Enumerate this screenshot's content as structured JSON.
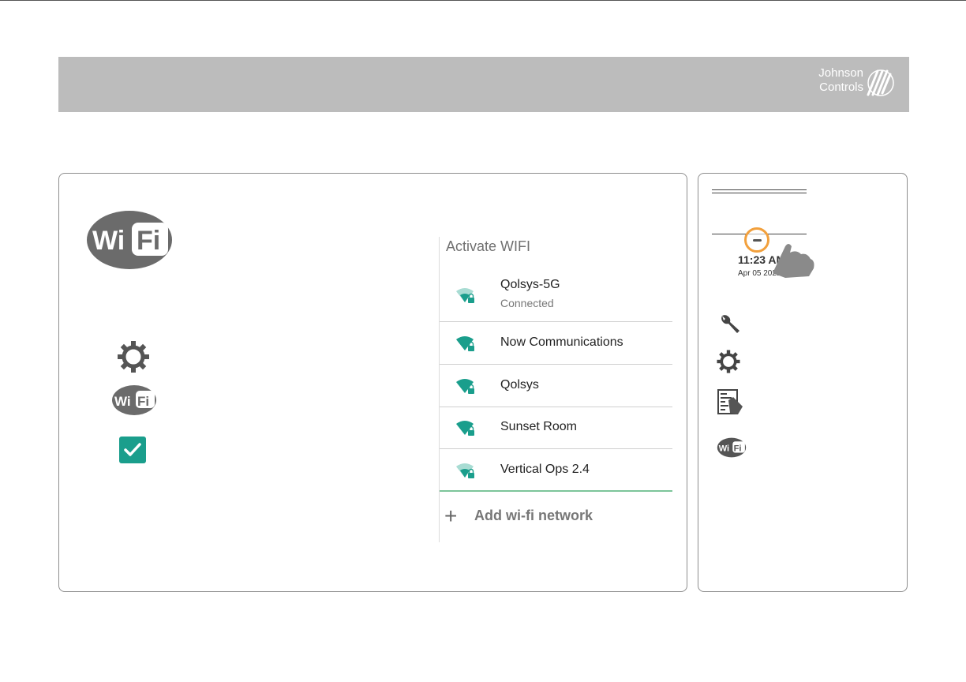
{
  "brand": {
    "line1": "Johnson",
    "line2": "Controls"
  },
  "main_logo": {
    "left": "Wi",
    "right": "Fi"
  },
  "screen": {
    "title": "Activate WIFI",
    "networks": [
      {
        "name": "Qolsys-5G",
        "status": "Connected",
        "signal": "partial"
      },
      {
        "name": "Now Communications",
        "status": "",
        "signal": "full"
      },
      {
        "name": "Qolsys",
        "status": "",
        "signal": "full"
      },
      {
        "name": "Sunset Room",
        "status": "",
        "signal": "full"
      },
      {
        "name": "Vertical Ops 2.4",
        "status": "",
        "signal": "partial"
      }
    ],
    "add_label": "Add wi-fi network"
  },
  "status_bar": {
    "time": "11:23 AM",
    "date": "Apr 05 2021"
  },
  "icons": {
    "settings": "gear-icon",
    "wifi": "wifi-badge-icon",
    "checkbox": "checkbox-checked-icon",
    "tools": "wrench-icon",
    "installer": "panel-touch-icon"
  },
  "colors": {
    "accent": "#1a9e8c",
    "header": "#bcbcbc",
    "highlight": "#f2a03c",
    "divider": "#7cc59a"
  }
}
